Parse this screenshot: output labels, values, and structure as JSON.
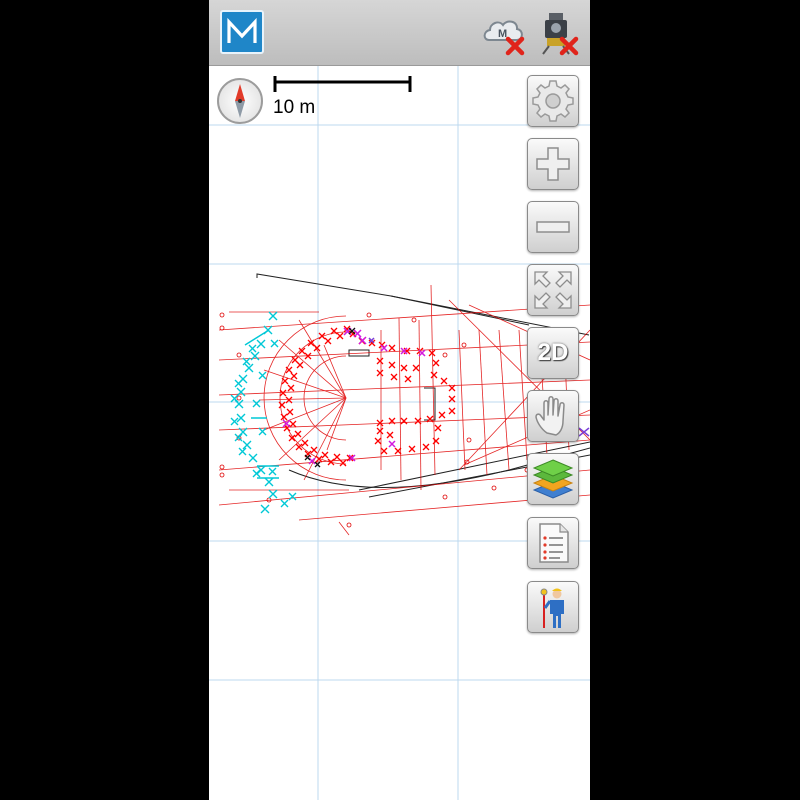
{
  "app": {
    "logo_letter": "M",
    "accent_color": "#1f86c8"
  },
  "status_icons": [
    {
      "name": "cloud-disconnected-icon",
      "badge_letter": "M",
      "state": "disconnected"
    },
    {
      "name": "instrument-disconnected-icon",
      "state": "disconnected"
    }
  ],
  "map": {
    "scale_label": "10 m",
    "colors": {
      "survey_lines": "#e00000",
      "points_cyan": "#00c8d6",
      "points_magenta": "#d21adf",
      "points_purple": "#7a3fd8",
      "grid": "#bcd9ef"
    }
  },
  "toolbar": {
    "buttons": [
      {
        "id": "settings",
        "icon": "gear-icon"
      },
      {
        "id": "zoom-in",
        "icon": "plus-icon"
      },
      {
        "id": "zoom-out",
        "icon": "minus-icon"
      },
      {
        "id": "zoom-extents",
        "icon": "expand-arrows-icon"
      },
      {
        "id": "view-mode",
        "label": "2D"
      },
      {
        "id": "pan",
        "icon": "hand-icon"
      },
      {
        "id": "layers",
        "icon": "layers-icon"
      },
      {
        "id": "point-list",
        "icon": "document-list-icon"
      },
      {
        "id": "surveyor",
        "icon": "surveyor-icon"
      }
    ]
  }
}
